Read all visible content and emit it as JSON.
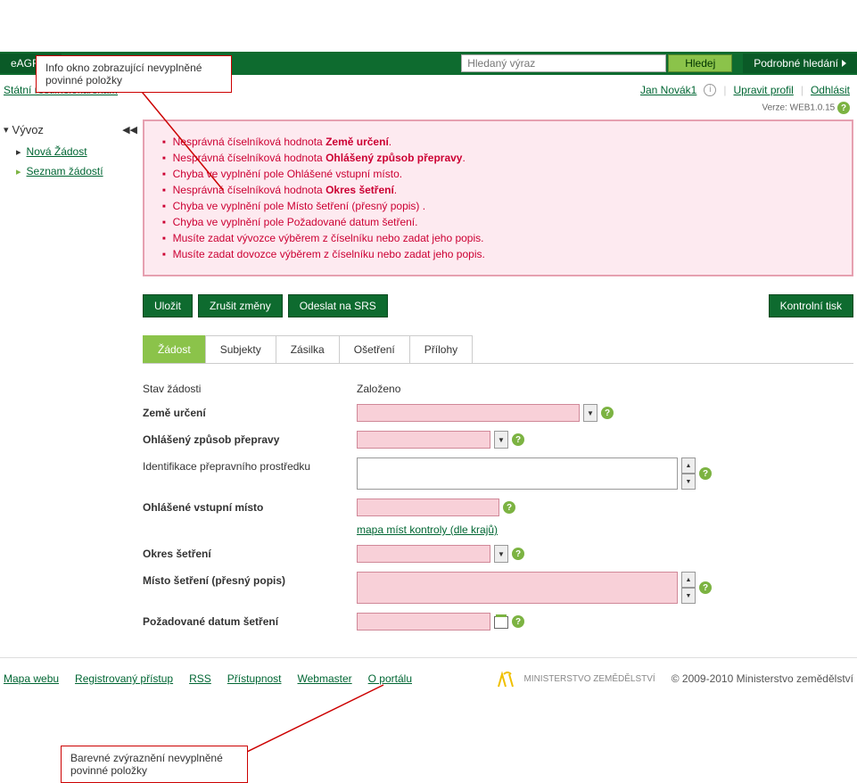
{
  "callouts": {
    "top": "Info okno zobrazující nevyplněné povinné položky",
    "bottom": "Barevné zvýraznění nevyplněné povinné položky"
  },
  "topbar": {
    "brand": "eAGRI",
    "search_placeholder": "Hledaný výraz",
    "search_btn": "Hledej",
    "adv_search": "Podrobné hledání"
  },
  "breadcrumb": {
    "link": "Státní rostlinolékařská...",
    "sep": ">"
  },
  "user": {
    "name": "Jan Novák1",
    "edit_profile": "Upravit profil",
    "logout": "Odhlásit"
  },
  "version": {
    "label": "Verze:",
    "value": "WEB1.0.15"
  },
  "sidebar": {
    "title": "Vývoz",
    "items": [
      {
        "label": "Nová Žádost",
        "active": false
      },
      {
        "label": "Seznam žádostí",
        "active": true
      }
    ]
  },
  "errors": [
    {
      "pre": "Nesprávná číselníková hodnota ",
      "bold": "Země určení",
      "post": "."
    },
    {
      "pre": "Nesprávná číselníková hodnota ",
      "bold": "Ohlášený způsob přepravy",
      "post": "."
    },
    {
      "pre": "Chyba ve vyplnění pole Ohlášené vstupní místo.",
      "bold": "",
      "post": ""
    },
    {
      "pre": "Nesprávná číselníková hodnota ",
      "bold": "Okres šetření",
      "post": "."
    },
    {
      "pre": "Chyba ve vyplnění pole Místo šetření (přesný popis) .",
      "bold": "",
      "post": ""
    },
    {
      "pre": "Chyba ve vyplnění pole Požadované datum šetření.",
      "bold": "",
      "post": ""
    },
    {
      "pre": "Musíte zadat vývozce výběrem z číselníku nebo zadat jeho popis.",
      "bold": "",
      "post": ""
    },
    {
      "pre": "Musíte zadat dovozce výběrem z číselníku nebo zadat jeho popis.",
      "bold": "",
      "post": ""
    }
  ],
  "buttons": {
    "save": "Uložit",
    "cancel": "Zrušit změny",
    "send": "Odeslat na SRS",
    "print": "Kontrolní tisk"
  },
  "tabs": [
    {
      "label": "Žádost",
      "active": true
    },
    {
      "label": "Subjekty",
      "active": false
    },
    {
      "label": "Zásilka",
      "active": false
    },
    {
      "label": "Ošetření",
      "active": false
    },
    {
      "label": "Přílohy",
      "active": false
    }
  ],
  "form": {
    "status_label": "Stav žádosti",
    "status_value": "Založeno",
    "country_label": "Země určení",
    "transport_label": "Ohlášený způsob přepravy",
    "vehicle_label": "Identifikace přepravního prostředku",
    "entry_label": "Ohlášené vstupní místo",
    "map_link": "mapa míst kontroly (dle krajů)",
    "district_label": "Okres šetření",
    "place_label": "Místo šetření (přesný popis)",
    "date_label": "Požadované datum šetření"
  },
  "footer": {
    "links": [
      "Mapa webu",
      "Registrovaný přístup",
      "RSS",
      "Přístupnost",
      "Webmaster",
      "O portálu"
    ],
    "ministry": "MINISTERSTVO ZEMĚDĚLSTVÍ",
    "copy": "© 2009-2010 Ministerstvo zemědělství"
  }
}
